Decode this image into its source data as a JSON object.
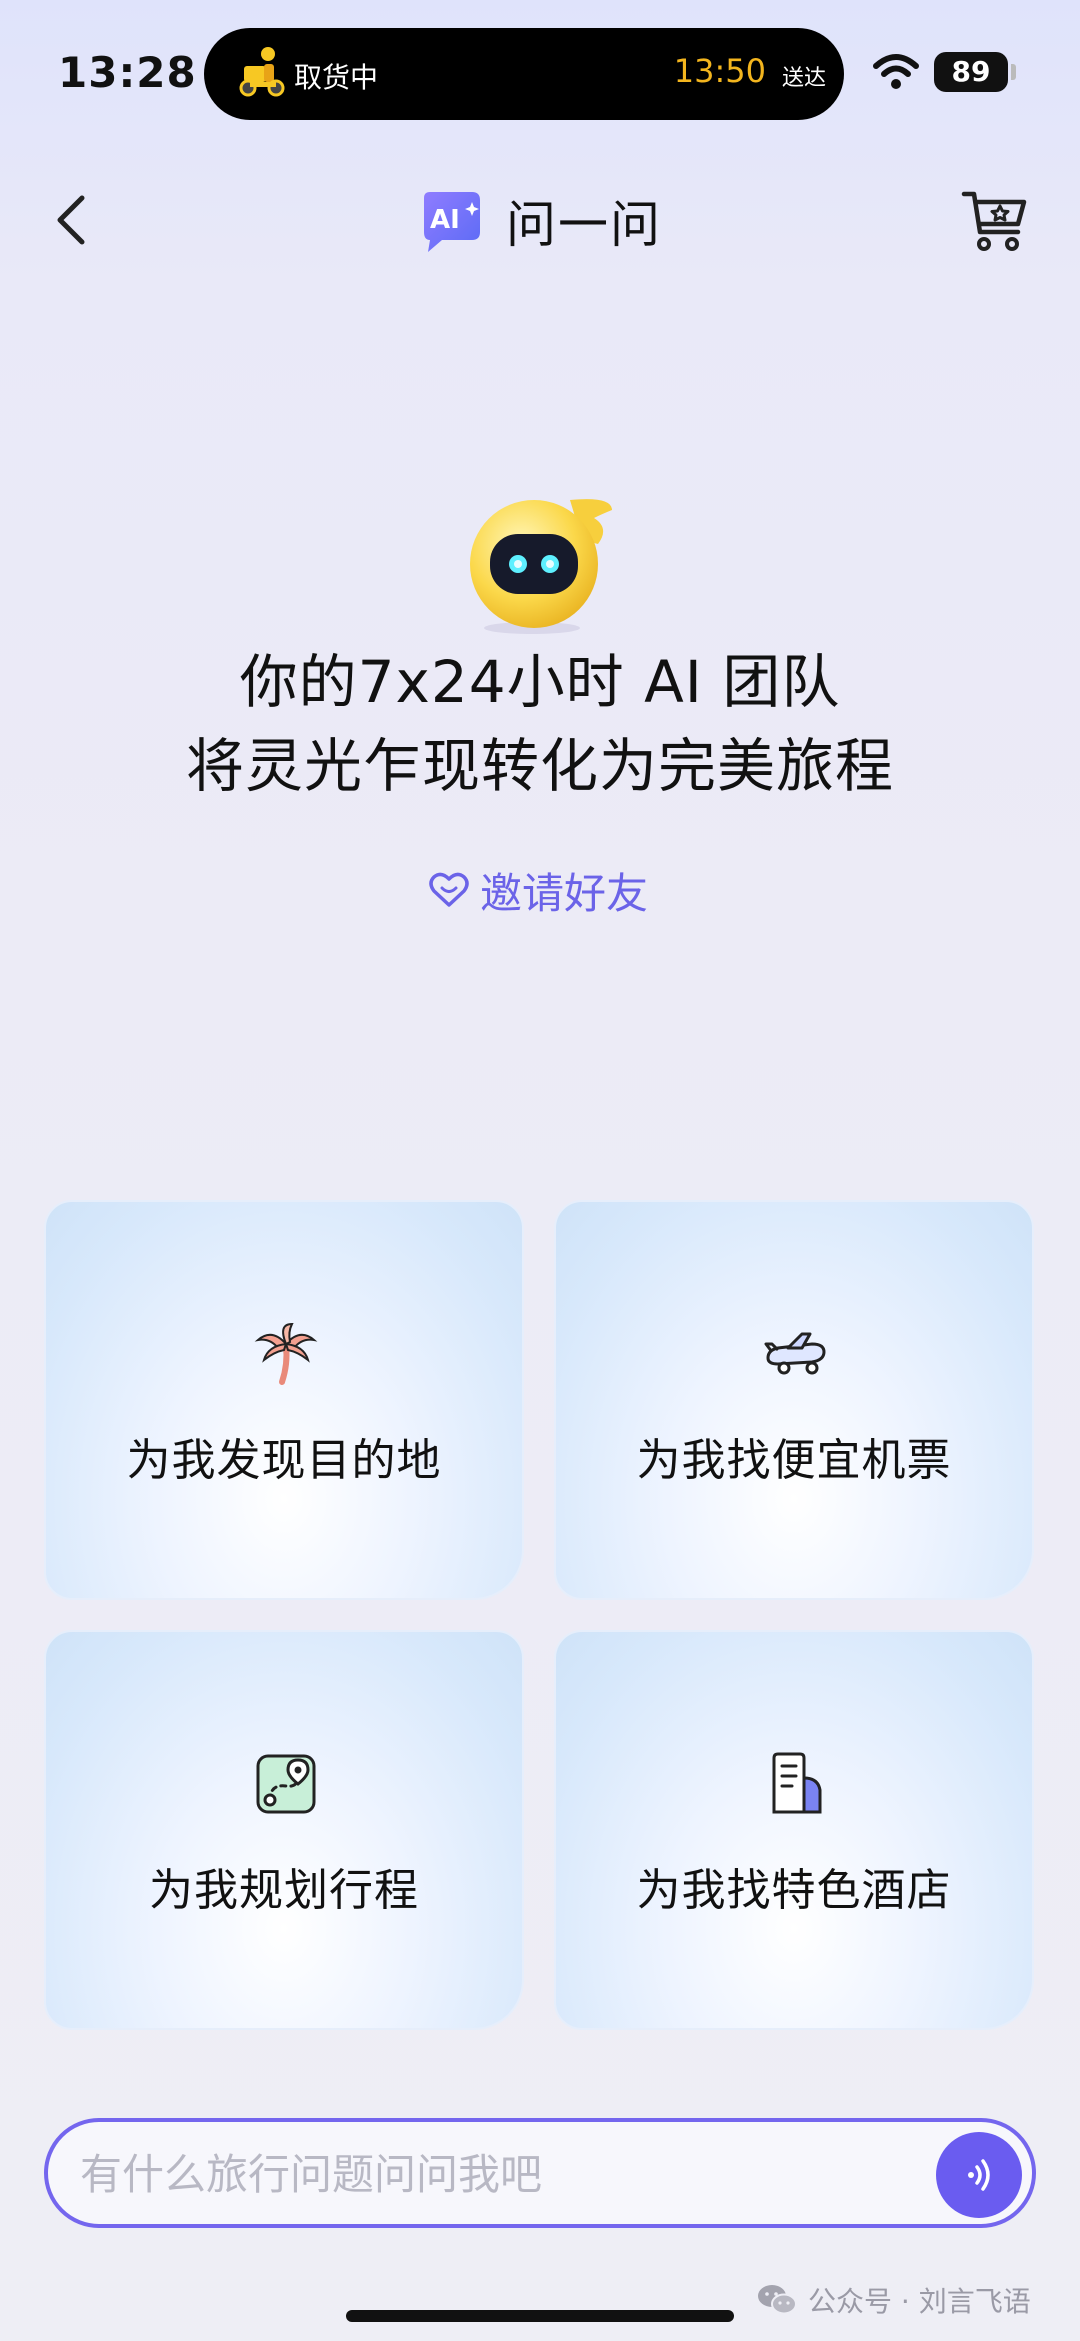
{
  "status": {
    "time": "13:28",
    "order_status": "取货中",
    "eta": "13:50",
    "eta_label": "送达",
    "battery": "89"
  },
  "nav": {
    "ai_badge": "AI",
    "title": "问一问"
  },
  "hero": {
    "line1": "你的7x24小时 AI 团队",
    "line2": "将灵光乍现转化为完美旅程",
    "invite": "邀请好友"
  },
  "cards": [
    {
      "label": "为我发现目的地",
      "icon": "palm-tree-icon"
    },
    {
      "label": "为我找便宜机票",
      "icon": "plane-icon"
    },
    {
      "label": "为我规划行程",
      "icon": "route-map-icon"
    },
    {
      "label": "为我找特色酒店",
      "icon": "hotel-icon"
    }
  ],
  "input": {
    "placeholder": "有什么旅行问题问问我吧",
    "value": ""
  },
  "watermark": {
    "text": "公众号 · 刘言飞语"
  },
  "colors": {
    "accent": "#6a5cf0",
    "eta": "#f3b51e",
    "invite": "#6b63e8"
  }
}
